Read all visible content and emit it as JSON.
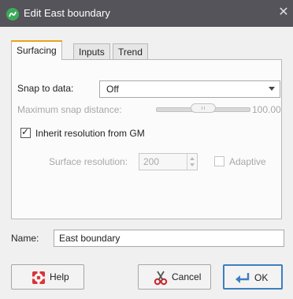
{
  "window": {
    "title": "Edit East boundary",
    "close_glyph": "✕"
  },
  "tabs": [
    {
      "label": "Surfacing",
      "active": true
    },
    {
      "label": "Inputs",
      "active": false
    },
    {
      "label": "Trend",
      "active": false
    }
  ],
  "surfacing": {
    "snap_label": "Snap to data:",
    "snap_value": "Off",
    "max_snap_label": "Maximum snap distance:",
    "max_snap_value": "100.00",
    "max_snap_fraction": 0.5,
    "inherit_label": "Inherit resolution from GM",
    "inherit_checked": true,
    "resolution_label": "Surface resolution:",
    "resolution_value": "200",
    "adaptive_label": "Adaptive",
    "adaptive_checked": false
  },
  "name": {
    "label": "Name:",
    "value": "East boundary"
  },
  "buttons": {
    "help": "Help",
    "cancel": "Cancel",
    "ok": "OK"
  },
  "icons": {
    "app": "surface-icon",
    "help": "lifebuoy-icon",
    "cancel": "scissors-icon",
    "ok": "return-arrow-icon"
  },
  "colors": {
    "titlebar": "#54545a",
    "active_tab_accent": "#e8a41a",
    "ok_border": "#3d7ebf"
  }
}
